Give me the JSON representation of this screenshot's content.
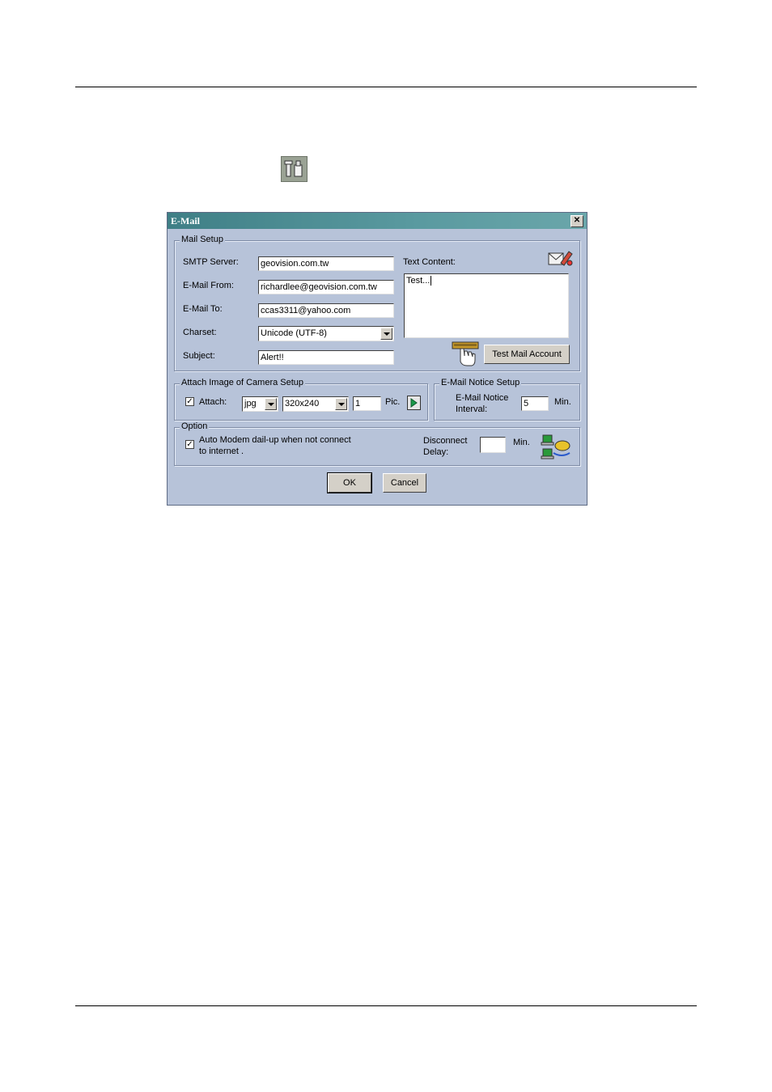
{
  "dialog": {
    "title": "E-Mail",
    "close_glyph": "✕",
    "mail_setup": {
      "legend": "Mail Setup",
      "smtp_label": "SMTP Server:",
      "smtp_value": "geovision.com.tw",
      "from_label": "E-Mail From:",
      "from_value": "richardlee@geovision.com.tw",
      "to_label": "E-Mail To:",
      "to_value": "ccas3311@yahoo.com",
      "charset_label": "Charset:",
      "charset_value": "Unicode (UTF-8)",
      "subject_label": "Subject:",
      "subject_value": "Alert!!",
      "text_content_label": "Text Content:",
      "text_content_value": "Test...",
      "test_button": "Test Mail Account"
    },
    "attach": {
      "legend": "Attach Image of Camera Setup",
      "checkbox_label": "Attach:",
      "checked_glyph": "✓",
      "format_value": "jpg",
      "size_value": "320x240",
      "count_value": "1",
      "count_unit": "Pic."
    },
    "notice": {
      "legend": "E-Mail Notice Setup",
      "interval_label_1": "E-Mail Notice",
      "interval_label_2": "Interval:",
      "interval_value": "5",
      "interval_unit": "Min."
    },
    "option": {
      "legend": "Option",
      "modem_label_1": "Auto Modem dail-up when not connect",
      "modem_label_2": "to internet .",
      "checked_glyph": "✓",
      "disconnect_label_1": "Disconnect",
      "disconnect_label_2": "Delay:",
      "disconnect_value": "",
      "disconnect_unit": "Min."
    },
    "ok_button": "OK",
    "cancel_button": "Cancel"
  },
  "colors": {
    "dialog_bg": "#b7c3d9",
    "titlebar": "#3f7f86"
  }
}
